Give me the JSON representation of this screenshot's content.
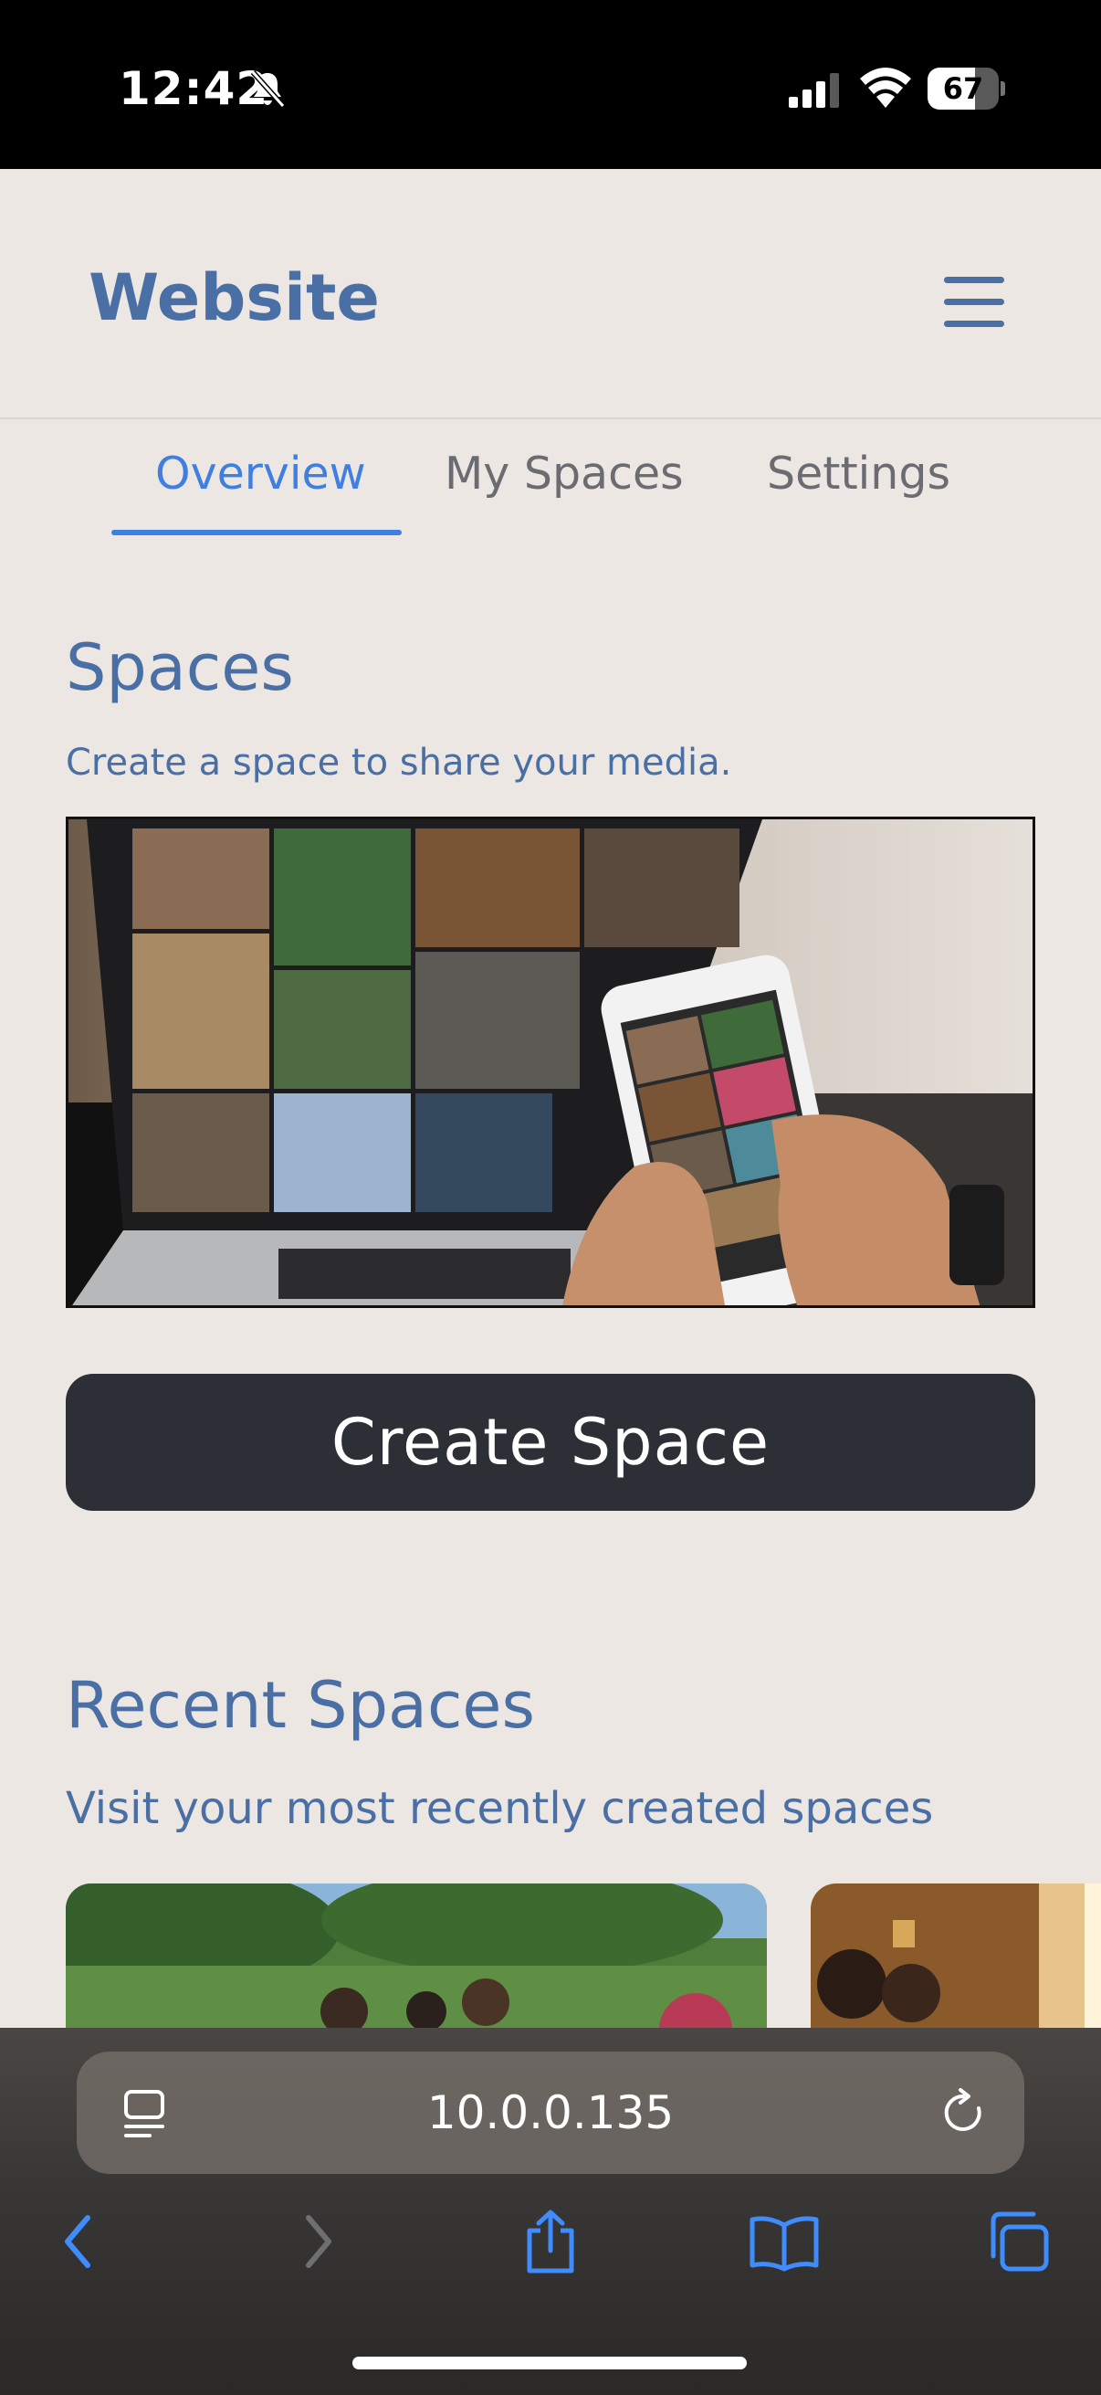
{
  "status_bar": {
    "time": "12:42",
    "battery": "67",
    "battery_level": 0.67
  },
  "header": {
    "title": "Website"
  },
  "tabs": [
    {
      "label": "Overview",
      "active": true
    },
    {
      "label": "My Spaces",
      "active": false
    },
    {
      "label": "Settings",
      "active": false
    }
  ],
  "spaces": {
    "title": "Spaces",
    "subtitle": "Create a space to share your media.",
    "create_button": "Create Space"
  },
  "recent": {
    "title": "Recent Spaces",
    "subtitle": "Visit your most recently created spaces"
  },
  "browser": {
    "url": "10.0.0.135"
  },
  "colors": {
    "accent": "#3f7fe0",
    "brand": "#4a6fa5",
    "button": "#2d2f36",
    "background": "#ede7e3"
  }
}
